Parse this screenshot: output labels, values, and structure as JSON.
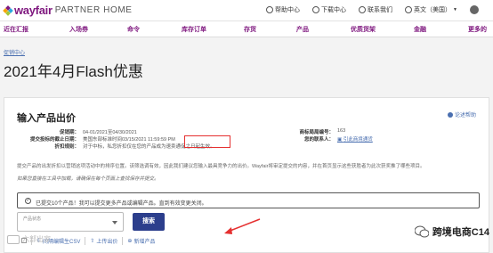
{
  "brand": {
    "name": "wayfair",
    "sub": "PARTNER HOME",
    "color": "#7f187f"
  },
  "toplinks": [
    {
      "icon": "help-circle-icon",
      "label": "帮助中心"
    },
    {
      "icon": "download-icon",
      "label": "下载中心"
    },
    {
      "icon": "mail-icon",
      "label": "联系我们"
    },
    {
      "icon": "globe-icon",
      "label": "英文（美国）"
    }
  ],
  "nav": [
    "近在汇报",
    "入场券",
    "命令",
    "库存订单",
    "存货",
    "产品",
    "优质货架",
    "金融",
    "更多的"
  ],
  "breadcrumb": "促销中心",
  "page_title": "2021年4月Flash优惠",
  "card": {
    "title": "输入产品出价",
    "help": "论述帮助",
    "left_fields": [
      {
        "label": "促销期：",
        "value": "04-01/2021至04/30/2021"
      },
      {
        "label": "提交投标的截止日期：",
        "value": "美国东部标准时间03/15/2021 11:59:59 PM"
      },
      {
        "label": "折扣规则：",
        "value": "对于中标，私您折扣仅在您的产品成为速卖通促之日起生效。"
      }
    ],
    "right_fields": [
      {
        "label": "商标局局编号：",
        "value": "163"
      },
      {
        "label": "您的联系人：",
        "value": "引此商境通货"
      }
    ],
    "desc1": "提交产品的出发折扣以营销这项活动中的排序位置。该筛选调有效，因此我们建议您输入最具竞争力的出价。Wayfair将审定提交的内容，并在首页显示这些获胜者为此次获奖推了哪些项目。",
    "desc2": "如果您直接在工具中加载，请确保在每个页面上查找保存并提交。",
    "notice": "已提交10个产品！我可以提交更多产品或编辑产品。直到有效变更关闭。",
    "status_placeholder": "产品状态",
    "search_label": "搜索",
    "actions": [
      {
        "label": "",
        "icon": "checkbox-icon"
      },
      {
        "label": "间隔编辑生CSV",
        "icon": "download-icon"
      },
      {
        "label": "上传出价",
        "icon": "upload-icon"
      },
      {
        "label": "新增产品",
        "icon": "plus-circle-icon"
      }
    ]
  },
  "watermarks": {
    "left": "六部出家",
    "right": "跨境电商C14"
  }
}
